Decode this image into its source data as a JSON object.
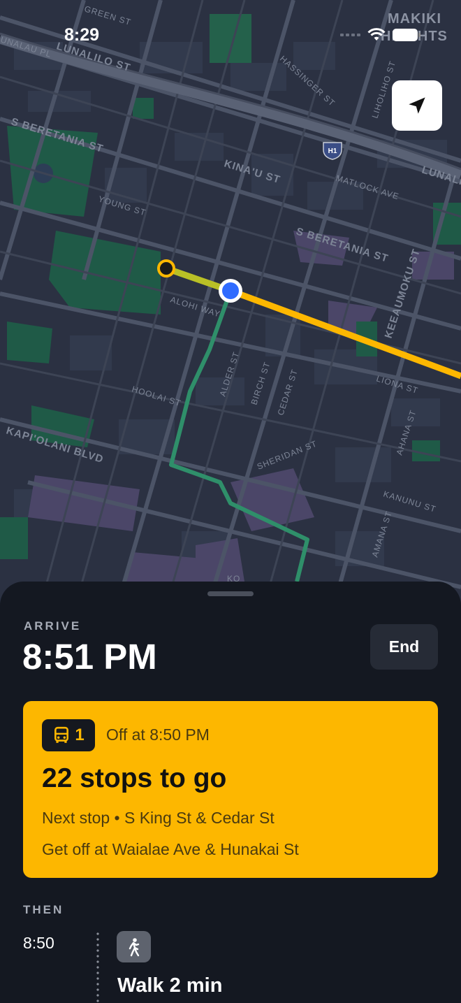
{
  "status_bar": {
    "time": "8:29"
  },
  "map": {
    "neighborhood": [
      "MAKIKI",
      "HEIGHTS"
    ],
    "streets": {
      "green": "GREEN ST",
      "lunalilo_top": "LUNALILO ST",
      "lunali_left": "UNALAU PL",
      "hassinger": "HASSINGER ST",
      "lihol": "LIHOLIHO ST",
      "beretania_left": "S BERETANIA ST",
      "kinau": "KINA'U ST",
      "h1": "H1",
      "matlock": "MATLOCK AVE",
      "lunali_right": "LUNALI",
      "young": "YOUNG ST",
      "beretania_right": "S BERETANIA ST",
      "keeaumoku": "KEEAUMOKU ST",
      "alohi": "ALOHI WAY",
      "alder": "ALDER ST",
      "birch": "BIRCH ST",
      "cedar": "CEDAR ST",
      "liona": "LIONA ST",
      "hoolai": "HOOLAI ST",
      "kapiolani": "KAPI'OLANI BLVD",
      "sheridan": "SHERIDAN ST",
      "ahana": "AHANA ST",
      "kanunu": "KANUNU ST",
      "amana": "AMANA ST",
      "ko": "KO"
    },
    "colors": {
      "transit_route": "#fdb700",
      "walk_route": "#2f8f6a",
      "current_location": "#2f6bff"
    }
  },
  "sheet": {
    "arrive_label": "ARRIVE",
    "arrive_time": "8:51 PM",
    "end_label": "End",
    "card": {
      "route_number": "1",
      "off_at": "Off at 8:50 PM",
      "stops_to_go": "22 stops to go",
      "next_stop": "Next stop • S King St & Cedar St",
      "get_off": "Get off at Waialae Ave & Hunakai St",
      "color": "#fdb700"
    },
    "then_label": "THEN",
    "next_step": {
      "time": "8:50",
      "label": "Walk 2 min",
      "icon": "walk-icon"
    }
  }
}
